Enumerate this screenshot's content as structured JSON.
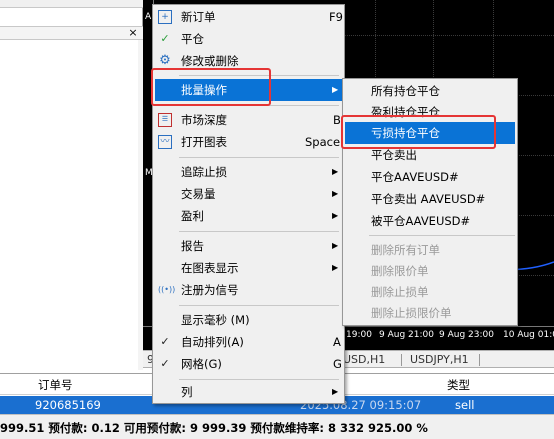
{
  "main_menu": {
    "items": [
      {
        "label": "新订单",
        "shortcut": "F9",
        "icon": "plus-doc-icon"
      },
      {
        "label": "平仓",
        "icon": "check-icon"
      },
      {
        "label": "修改或删除",
        "icon": "gear-icon"
      },
      {
        "label": "批量操作",
        "has_submenu": true,
        "highlighted": true
      },
      {
        "label": "市场深度",
        "shortcut": "B",
        "icon": "depth-grid-icon"
      },
      {
        "label": "打开图表",
        "shortcut": "Space",
        "icon": "line-chart-icon"
      },
      {
        "label": "追踪止损",
        "has_submenu": true
      },
      {
        "label": "交易量",
        "has_submenu": true
      },
      {
        "label": "盈利",
        "has_submenu": true
      },
      {
        "label": "报告",
        "has_submenu": true
      },
      {
        "label": "在图表显示",
        "has_submenu": true
      },
      {
        "label": "注册为信号",
        "icon": "signal-icon"
      },
      {
        "label": "显示毫秒 (M)"
      },
      {
        "label": "自动排列(A)",
        "shortcut": "A",
        "checked": true
      },
      {
        "label": "网格(G)",
        "shortcut": "G",
        "checked": true
      },
      {
        "label": "列",
        "has_submenu": true
      }
    ]
  },
  "sub_menu": {
    "items": [
      {
        "label": "所有持仓平仓"
      },
      {
        "label": "盈利持仓平仓"
      },
      {
        "label": "亏损持仓平仓",
        "highlighted": true
      },
      {
        "label": "平仓卖出"
      },
      {
        "label": "平仓AAVEUSD#"
      },
      {
        "label": "平仓卖出 AAVEUSD#"
      },
      {
        "label": "被平仓AAVEUSD#"
      },
      {
        "label": "删除所有订单",
        "disabled": true
      },
      {
        "label": "删除限价单",
        "disabled": true
      },
      {
        "label": "删除止损单",
        "disabled": true
      },
      {
        "label": "删除止损限价单",
        "disabled": true
      }
    ]
  },
  "chart": {
    "left_markers": [
      "A",
      "M"
    ],
    "time_labels": [
      "19:00",
      "9 Aug 21:00",
      "9 Aug 23:00",
      "10 Aug 01:00"
    ],
    "tabs": [
      "USD,H1",
      "USDJPY,H1"
    ],
    "left_tab_fragment": "9"
  },
  "table": {
    "headers": {
      "order": "订单号",
      "type": "类型"
    },
    "row": {
      "order": "920685169",
      "type": "sell",
      "time_partial": "2025.08.27 09:15:07"
    }
  },
  "status": {
    "text": "999.51  预付款: 0.12  可用预付款: 9 999.39  预付款维持率: 8 332 925.00 %"
  },
  "colors": {
    "highlight": "#0a73d6",
    "annotation": "#e53535",
    "curve": "#2060ff"
  }
}
